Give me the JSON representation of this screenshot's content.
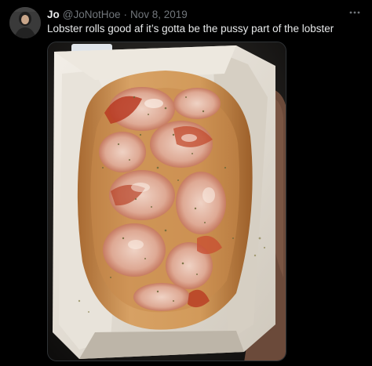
{
  "tweet": {
    "display_name": "Jo",
    "handle": "@JoNotHoe",
    "separator": "·",
    "date": "Nov 8, 2019",
    "text": "Lobster rolls good af it’s gotta be the pussy part of the lobster",
    "more_icon": "more-horizontal-icon",
    "media": {
      "alt": "Photo of a lobster roll in a white paper tray"
    }
  },
  "colors": {
    "background": "#000000",
    "text_primary": "#e7e9ea",
    "text_secondary": "#71767b",
    "border": "#2f3336"
  }
}
